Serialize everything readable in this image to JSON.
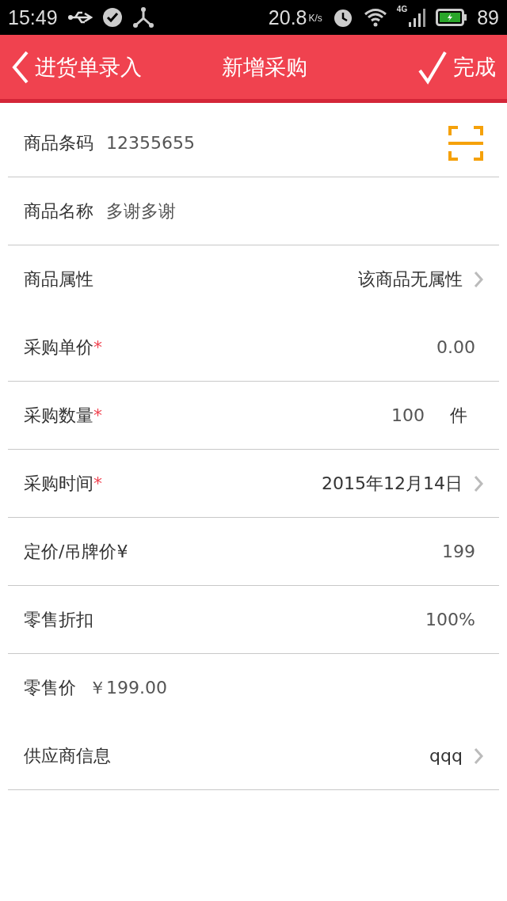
{
  "status_bar": {
    "time": "15:49",
    "speed": "20.8",
    "speed_unit": "K/s",
    "network": "4G",
    "battery": "89"
  },
  "header": {
    "back_label": "进货单录入",
    "title": "新增采购",
    "done_label": "完成"
  },
  "rows": [
    {
      "kind": "inline",
      "label": "商品条码",
      "value": "12355655",
      "scan": true,
      "divider": true
    },
    {
      "kind": "inline",
      "label": "商品名称",
      "value": "多谢多谢",
      "scan": false,
      "divider": true
    },
    {
      "kind": "picker",
      "label": "商品属性",
      "value": "该商品无属性",
      "divider": false
    },
    {
      "kind": "input",
      "label": "采购单价",
      "required_mark": "*",
      "value": "0.00",
      "divider": true
    },
    {
      "kind": "input",
      "label": "采购数量",
      "required_mark": "*",
      "value": "100",
      "unit": "件",
      "divider": true
    },
    {
      "kind": "picker",
      "label": "采购时间",
      "required_mark": "*",
      "value": "2015年12月14日",
      "divider": true
    },
    {
      "kind": "input",
      "label": "定价/吊牌价¥",
      "value": "199",
      "divider": true
    },
    {
      "kind": "input",
      "label": "零售折扣",
      "value": "100%",
      "divider": true
    },
    {
      "kind": "inline",
      "label": "零售价",
      "value": "￥199.00",
      "scan": false,
      "divider": false
    },
    {
      "kind": "picker",
      "label": "供应商信息",
      "value": "qqq",
      "divider": true
    }
  ]
}
